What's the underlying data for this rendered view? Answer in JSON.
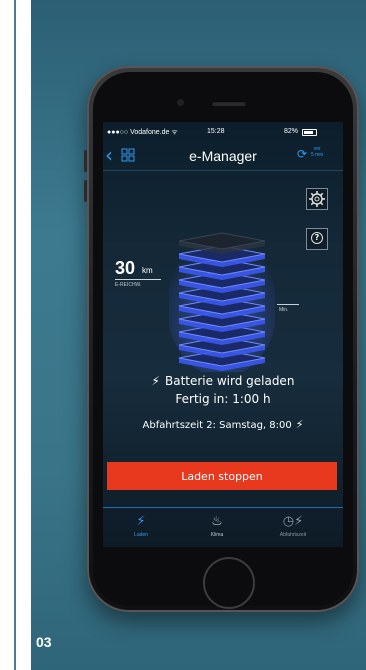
{
  "page_number": "03",
  "statusbar": {
    "carrier": "●●●○○ Vodafone.de ᯤ",
    "time": "15:28",
    "battery": "82%"
  },
  "navbar": {
    "title": "e-Manager",
    "refresh_label_line1": "vor",
    "refresh_label_line2": "5 min"
  },
  "range": {
    "value": "30",
    "unit": "km",
    "label": "E-REICHW."
  },
  "min_label": "Min.",
  "charge_level": 0.85,
  "charging": {
    "status": "Batterie wird geladen",
    "finish": "Fertig in: 1:00 h",
    "departure": "Abfahrtszeit 2: Samstag, 8:00"
  },
  "stop_button": "Laden stoppen",
  "tabs": [
    {
      "label": "Laden",
      "icon": "plug-icon"
    },
    {
      "label": "Klima",
      "icon": "seat-icon"
    },
    {
      "label": "Abfahrtszeit",
      "icon": "clock-plug-icon"
    }
  ],
  "colors": {
    "accent": "#2f9bf0",
    "stop_button": "#e8381e",
    "panel": "#3d7a90",
    "battery_glow": "#4a6cff"
  }
}
